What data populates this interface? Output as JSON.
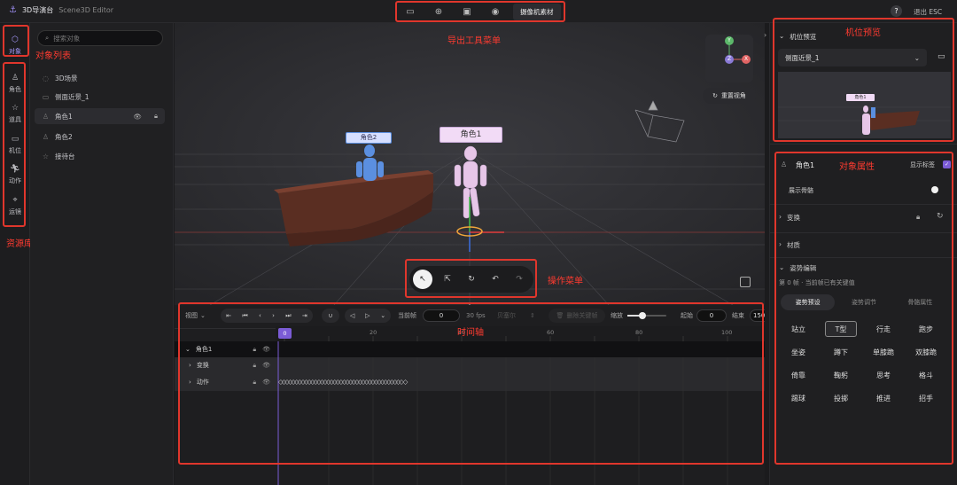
{
  "header": {
    "app_name": "3D导演台",
    "app_sub": "Scene3D Editor",
    "export_tools": {
      "camera_material": "摄像机素材"
    },
    "help": "?",
    "exit": "退出 ESC"
  },
  "left_nav": {
    "items": [
      {
        "label": "对象",
        "icon": "cube-icon"
      },
      {
        "label": "角色",
        "icon": "person-icon"
      },
      {
        "label": "道具",
        "icon": "prop-icon"
      },
      {
        "label": "机位",
        "icon": "camera-icon"
      },
      {
        "label": "动作",
        "icon": "run-icon"
      },
      {
        "label": "运镜",
        "icon": "camera-move-icon"
      }
    ]
  },
  "object_panel": {
    "search_placeholder": "搜索对象",
    "items": [
      {
        "label": "3D场景"
      },
      {
        "label": "侧面近景_1"
      },
      {
        "label": "角色1"
      },
      {
        "label": "角色2"
      },
      {
        "label": "接待台"
      }
    ]
  },
  "viewport": {
    "reset_view": "重置视角",
    "gizmo": {
      "y": "Y",
      "z": "Z",
      "x": "X"
    },
    "labels": {
      "char1": "角色1",
      "char2": "角色2"
    }
  },
  "timeline": {
    "view": "视图",
    "current_frame_label": "当前帧",
    "current_frame": "0",
    "fps": "30 fps",
    "interp": "贝塞尔",
    "delete_key": "删除关键帧",
    "zoom_label": "缩放",
    "start_label": "起始",
    "start_value": "0",
    "end_label": "结束",
    "end_value": "150",
    "ruler": [
      "0",
      "20",
      "40",
      "60",
      "80",
      "100"
    ],
    "tracks": [
      {
        "label": "角色1"
      },
      {
        "label": "变换"
      },
      {
        "label": "动作"
      }
    ]
  },
  "right_panel": {
    "camera_preview_title": "机位预览",
    "camera_select": "侧面近景_1",
    "preview_label": "角色1",
    "object_name": "角色1",
    "show_tag": "显示标签",
    "show_skeleton": "展示骨骼",
    "transform": "变换",
    "material": "材质",
    "pose_edit": "姿势编辑",
    "pose_hint": "第 0 帧 · 当前帧已有关键值",
    "pose_tabs": [
      "姿势预设",
      "姿势调节",
      "骨骼属性"
    ],
    "poses": [
      "站立",
      "T型",
      "行走",
      "跑步",
      "坐姿",
      "蹲下",
      "单膝跪",
      "双膝跪",
      "倚靠",
      "鞠躬",
      "思考",
      "格斗",
      "踢球",
      "投掷",
      "推进",
      "招手"
    ]
  },
  "annotations": {
    "object_list": "对象列表",
    "asset_library": "资源库",
    "export_menu": "导出工具菜单",
    "camera_preview": "机位预览",
    "object_props": "对象属性",
    "operation_menu": "操作菜单",
    "timeline": "时间轴"
  }
}
